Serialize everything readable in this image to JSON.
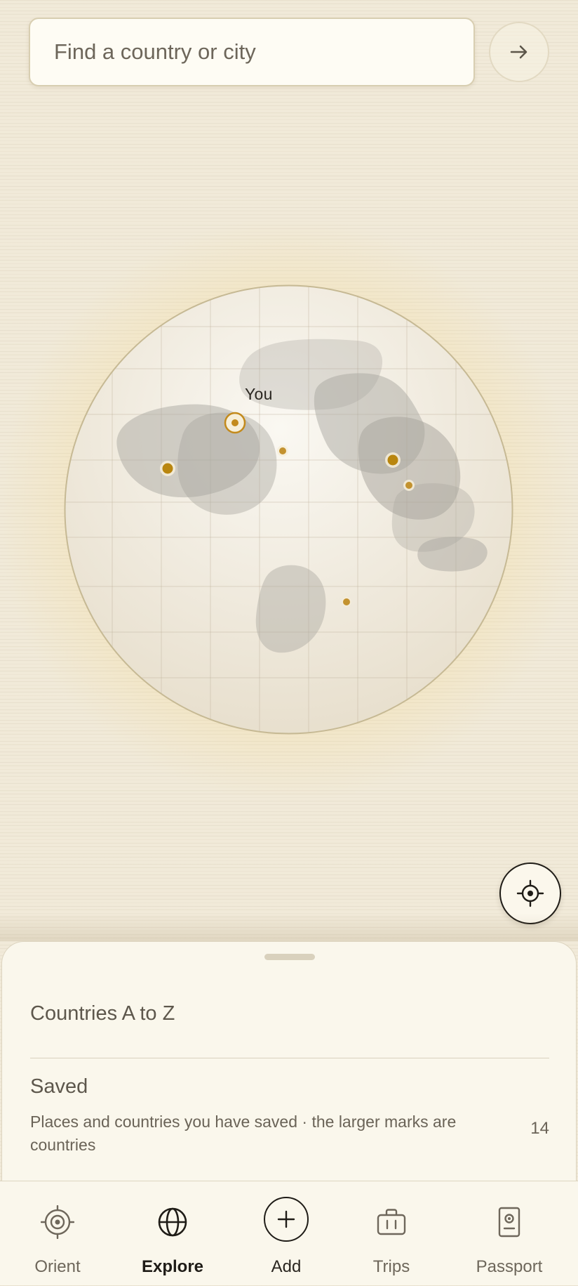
{
  "search": {
    "placeholder": "Find a country or city",
    "value": ""
  },
  "icons": {
    "go": "arrow-right-icon",
    "locate": "crosshair-icon",
    "orient": "target-icon",
    "explore": "globe-icon",
    "add": "plus-icon",
    "trips": "suitcase-icon",
    "passport": "passport-icon"
  },
  "globe": {
    "you_label": "You"
  },
  "sheet": {
    "az_label": "Countries A to Z",
    "saved": {
      "title": "Saved",
      "description": "Places and countries you have saved · the larger marks are countries",
      "count": "14"
    }
  },
  "tabs": [
    {
      "label": "Orient",
      "active": false
    },
    {
      "label": "Explore",
      "active": true
    },
    {
      "label": "Add",
      "active": false
    },
    {
      "label": "Trips",
      "active": false
    },
    {
      "label": "Passport",
      "active": false
    }
  ],
  "colors": {
    "accent": "#c38a1c",
    "background": "#f1ead9",
    "sheet": "#faf7ec",
    "text": "#1f1c17"
  }
}
